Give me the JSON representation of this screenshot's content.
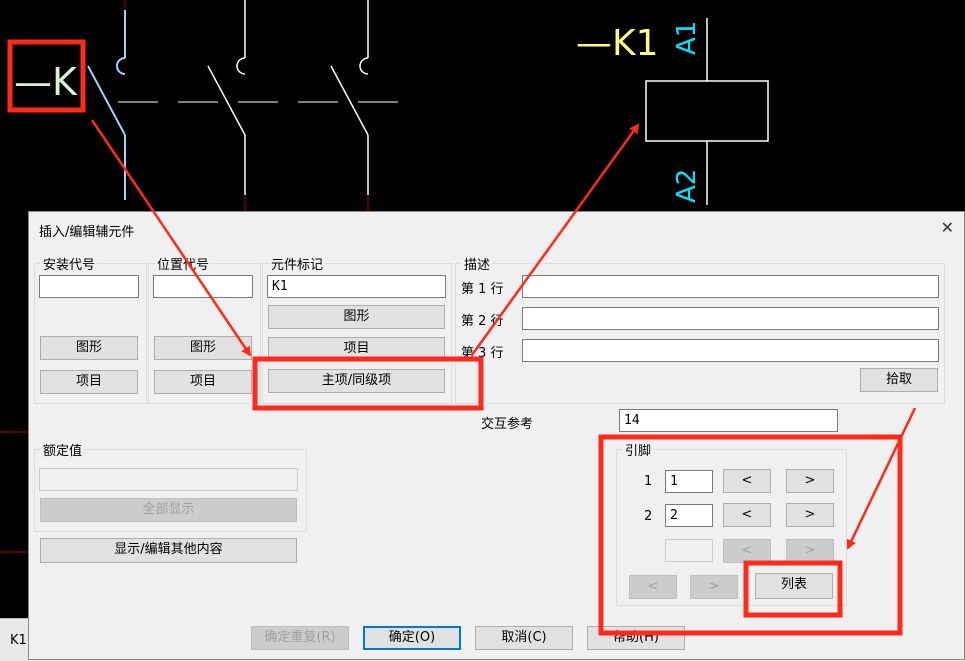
{
  "schematic": {
    "left_tag": "—K",
    "right_tag": "—K1",
    "pin_a1": "A1",
    "pin_a2": "A2"
  },
  "statusbar": {
    "text": "K1"
  },
  "dialog": {
    "title": "插入/编辑辅元件",
    "install_code": {
      "legend": "安装代号",
      "value": "",
      "graphic_btn": "图形",
      "project_btn": "项目"
    },
    "location_code": {
      "legend": "位置代号",
      "value": "",
      "graphic_btn": "图形",
      "project_btn": "项目"
    },
    "component_tag": {
      "legend": "元件标记",
      "value": "K1",
      "graphic_btn": "图形",
      "project_btn": "项目",
      "main_peer_btn": "主项/同级项"
    },
    "description": {
      "legend": "描述",
      "lines": [
        {
          "label": "第 1 行",
          "value": ""
        },
        {
          "label": "第 2 行",
          "value": ""
        },
        {
          "label": "第 3 行",
          "value": ""
        }
      ],
      "pick_btn": "拾取"
    },
    "cross_ref": {
      "label": "交互参考",
      "value": "14"
    },
    "rating": {
      "legend": "额定值",
      "value": "",
      "show_all_btn": "全部显示"
    },
    "show_edit_other_btn": "显示/编辑其他内容",
    "pins": {
      "legend": "引脚",
      "rows": [
        {
          "num": "1",
          "value": "1"
        },
        {
          "num": "2",
          "value": "2"
        }
      ],
      "prev": "<",
      "next": ">",
      "list_btn": "列表"
    },
    "footer": {
      "ok_repeat": "确定重复(R)",
      "ok": "确定(O)",
      "cancel": "取消(C)",
      "help": "帮助(H)"
    }
  },
  "colors": {
    "annotation_red": "#ff2a1a",
    "cad_cyan": "#00e5ff",
    "cad_yellow": "#ffff80",
    "dialog_bg": "#f0f0f0"
  }
}
